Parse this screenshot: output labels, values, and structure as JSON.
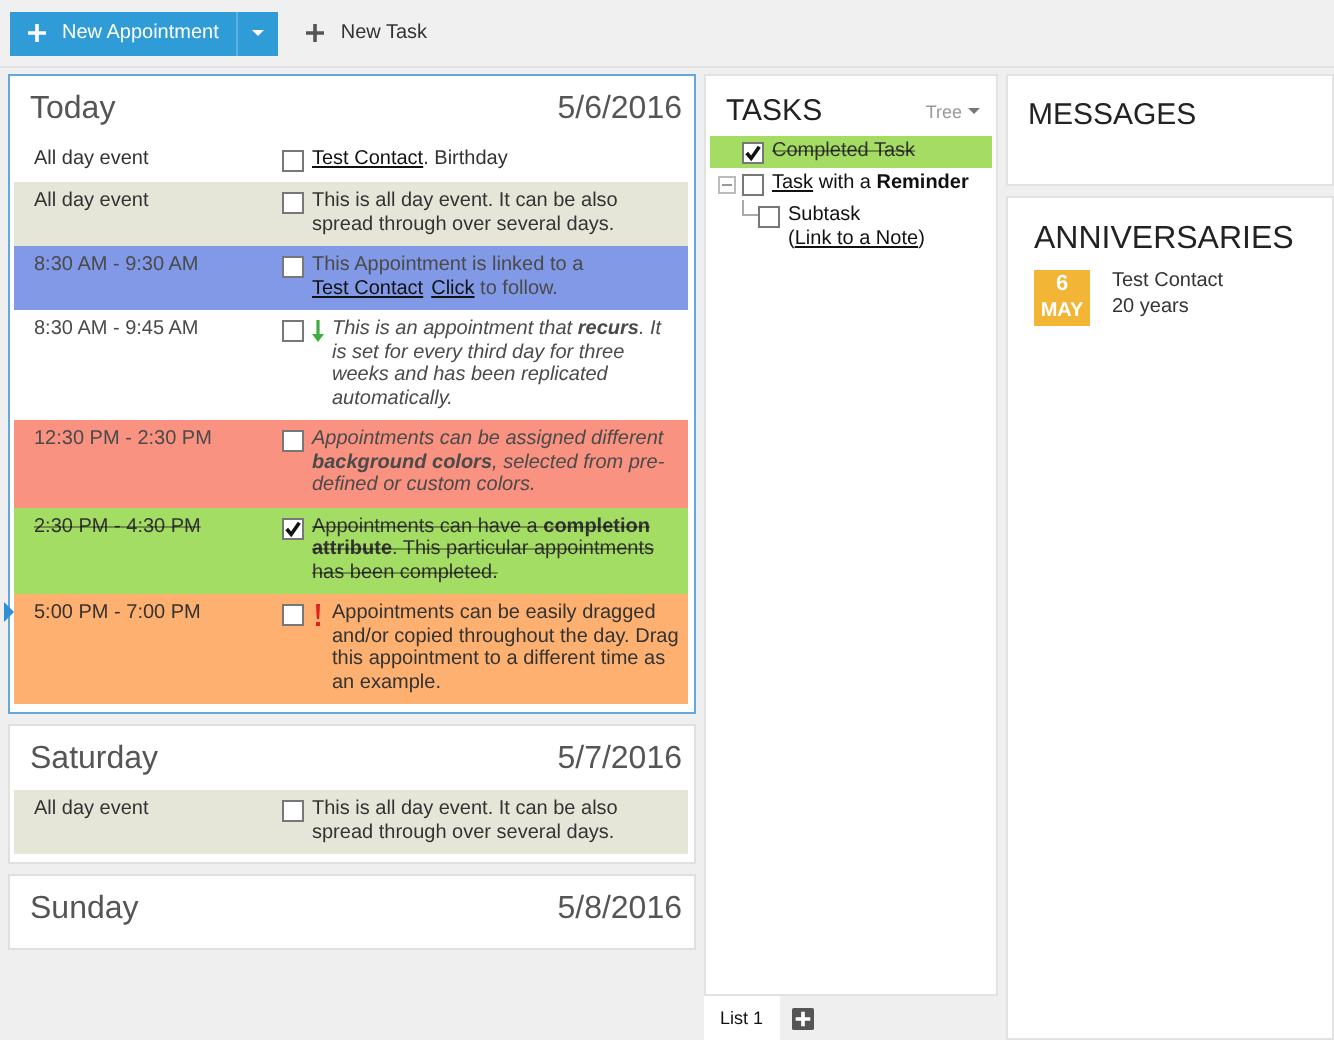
{
  "toolbar": {
    "new_appointment": "New Appointment",
    "new_task": "New Task"
  },
  "days": [
    {
      "name": "Today",
      "date": "5/6/2016",
      "selected": true,
      "events": [
        {
          "time": "All day event",
          "color": "#ffffff",
          "checked": false,
          "faded": false,
          "italic": false,
          "recurring": false,
          "important": false,
          "current": false,
          "text": [
            {
              "text": "Test Contact",
              "link": true
            },
            {
              "text": ". Birthday",
              "link": false
            }
          ]
        },
        {
          "time": "All day event",
          "color": "#e6e6d8",
          "checked": false,
          "faded": false,
          "italic": false,
          "recurring": false,
          "important": false,
          "current": false,
          "text": [
            {
              "text": "This is all day event. It can be also spread through over several days.",
              "link": false
            }
          ]
        },
        {
          "time": "8:30 AM - 9:30 AM",
          "color": "#8199e6",
          "checked": false,
          "faded": true,
          "italic": false,
          "recurring": false,
          "important": false,
          "current": false,
          "text": [
            {
              "text": "This Appointment is linked to a ",
              "link": false
            },
            {
              "text": "Test Contact",
              "link": true
            },
            {
              "text": "Click",
              "link": true
            },
            {
              "text": " to follow.",
              "link": false
            }
          ]
        },
        {
          "time": "8:30 AM - 9:45 AM",
          "color": "#ffffff",
          "checked": false,
          "faded": true,
          "italic": true,
          "recurring": true,
          "important": false,
          "current": false,
          "text": [
            {
              "text": "This is an appointment that **recurs**. It is set for every third day for three weeks and has been replicated automatically.",
              "link": false
            }
          ]
        },
        {
          "time": "12:30 PM - 2:30 PM",
          "color": "#fa9282",
          "checked": false,
          "faded": true,
          "italic": true,
          "recurring": false,
          "important": false,
          "current": false,
          "text": [
            {
              "text": "Appointments can be assigned different **background colors**, selected from pre-defined or custom colors.",
              "link": false
            }
          ]
        },
        {
          "time": "2:30 PM - 4:30 PM",
          "color": "#a3dd63",
          "checked": true,
          "faded": false,
          "italic": false,
          "recurring": false,
          "important": false,
          "current": false,
          "text": [
            {
              "text": "Appointments can have a **completion attribute**. This particular appointments has been completed.",
              "link": false
            }
          ]
        },
        {
          "time": "5:00 PM - 7:00 PM",
          "color": "#fdb06f",
          "checked": false,
          "faded": false,
          "italic": false,
          "recurring": false,
          "important": true,
          "current": true,
          "text": [
            {
              "text": "Appointments can be easily dragged and/or copied throughout the day. Drag this appointment to a different time as an example.",
              "link": false
            }
          ]
        }
      ]
    },
    {
      "name": "Saturday",
      "date": "5/7/2016",
      "selected": false,
      "events": [
        {
          "time": "All day event",
          "color": "#e6e6d8",
          "checked": false,
          "faded": false,
          "italic": false,
          "recurring": false,
          "important": false,
          "current": false,
          "text": [
            {
              "text": "This is all day event. It can be also spread through over several days.",
              "link": false
            }
          ]
        }
      ]
    },
    {
      "name": "Sunday",
      "date": "5/8/2016",
      "selected": false
    }
  ],
  "tasks": {
    "title": "TASKS",
    "view": "Tree",
    "items": [
      {
        "checked": true,
        "selected": true,
        "text": [
          {
            "text": "Completed Task",
            "link": false
          }
        ]
      },
      {
        "checked": false,
        "selected": false,
        "expanded": true,
        "text": [
          {
            "text": "Task",
            "link": true
          },
          {
            "text": " with a **Reminder**",
            "link": false
          }
        ],
        "children": [
          {
            "checked": false,
            "selected": false,
            "text": [
              {
                "text": "Subtask (",
                "link": false
              },
              {
                "text": "Link to a Note",
                "link": true
              },
              {
                "text": ")",
                "link": false
              }
            ]
          }
        ]
      }
    ],
    "tabs": [
      {
        "label": "List 1",
        "selected": true
      }
    ]
  },
  "messages": {
    "title": "MESSAGES"
  },
  "anniversaries": {
    "title": "ANNIVERSARIES",
    "items": [
      {
        "day": "6",
        "month": "MAY",
        "name": "Test Contact",
        "years": "20 years"
      }
    ]
  }
}
